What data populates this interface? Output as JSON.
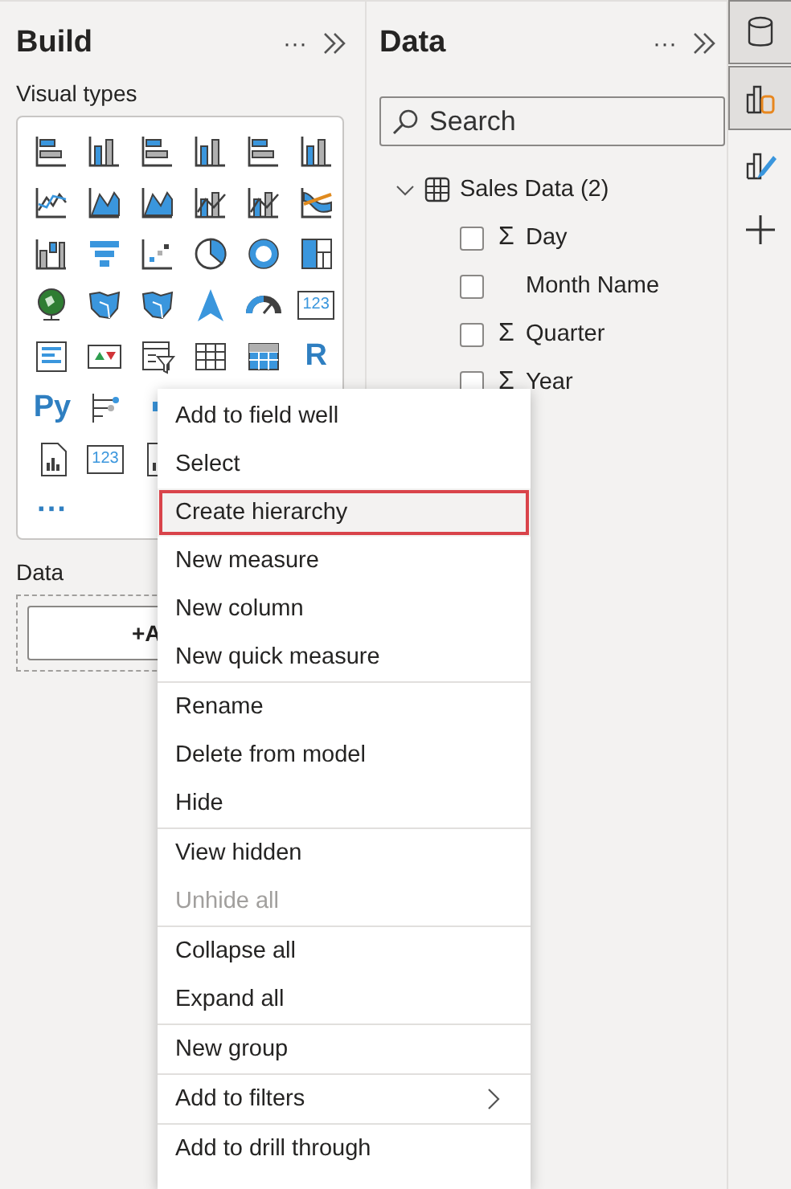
{
  "build_pane": {
    "title": "Build",
    "more": "···",
    "section_label": "Visual types",
    "visual_rows": [
      [
        {
          "kind": "hbar"
        },
        {
          "kind": "vbar"
        },
        {
          "kind": "hbar"
        },
        {
          "kind": "vbar"
        },
        {
          "kind": "hbar"
        },
        {
          "kind": "vbar"
        }
      ],
      [
        {
          "kind": "line"
        },
        {
          "kind": "area"
        },
        {
          "kind": "area"
        },
        {
          "kind": "combo"
        },
        {
          "kind": "combo"
        },
        {
          "kind": "ribbon"
        }
      ],
      [
        {
          "kind": "waterfall"
        },
        {
          "kind": "funnel"
        },
        {
          "kind": "scatter"
        },
        {
          "kind": "pie"
        },
        {
          "kind": "donut"
        },
        {
          "kind": "treemap"
        }
      ],
      [
        {
          "kind": "globe"
        },
        {
          "kind": "map"
        },
        {
          "kind": "map"
        },
        {
          "kind": "arrow"
        },
        {
          "kind": "gauge"
        },
        {
          "kind": "card",
          "text": "123"
        }
      ],
      [
        {
          "kind": "list"
        },
        {
          "kind": "kpi"
        },
        {
          "kind": "slicer"
        },
        {
          "kind": "table"
        },
        {
          "kind": "matrix"
        },
        {
          "kind": "letters",
          "text": "R"
        }
      ],
      [
        {
          "kind": "letters",
          "text": "Py"
        },
        {
          "kind": "tree"
        },
        {
          "kind": "key"
        }
      ],
      [
        {
          "kind": "report"
        },
        {
          "kind": "card",
          "text": "123"
        },
        {
          "kind": "report"
        }
      ],
      [
        {
          "kind": "letters",
          "text": "···"
        }
      ]
    ],
    "data_label": "Data",
    "add_button": "+A"
  },
  "data_pane": {
    "title": "Data",
    "more": "···",
    "search": {
      "placeholder": "Search"
    },
    "tables": [
      {
        "name": "Sales Data (2)",
        "expanded": true,
        "children": [
          {
            "name": "Day",
            "prefix": "Σ",
            "checked": false
          },
          {
            "name": "Month Name",
            "checked": false
          },
          {
            "name": "Quarter",
            "prefix": "Σ",
            "checked": false
          },
          {
            "name": "Year",
            "prefix": "Σ",
            "checked": false
          }
        ]
      }
    ]
  },
  "rail": [
    {
      "kind": "data",
      "selected": true
    },
    {
      "kind": "build",
      "selected": true
    },
    {
      "kind": "format",
      "selected": false
    },
    {
      "kind": "add",
      "selected": false
    }
  ],
  "context_menu": {
    "groups": [
      [
        {
          "label": "Add to field well",
          "selected": false,
          "disabled": false,
          "submenu": false
        },
        {
          "label": "Select",
          "selected": false,
          "disabled": false,
          "submenu": false
        },
        {
          "label": "Create hierarchy",
          "selected": true,
          "disabled": false,
          "submenu": false
        },
        {
          "label": "New measure",
          "selected": false,
          "disabled": false,
          "submenu": false
        },
        {
          "label": "New column",
          "selected": false,
          "disabled": false,
          "submenu": false
        },
        {
          "label": "New quick measure",
          "selected": false,
          "disabled": false,
          "submenu": false
        }
      ],
      [
        {
          "label": "Rename",
          "selected": false,
          "disabled": false,
          "submenu": false
        },
        {
          "label": "Delete from model",
          "selected": false,
          "disabled": false,
          "submenu": false
        },
        {
          "label": "Hide",
          "selected": false,
          "disabled": false,
          "submenu": false
        }
      ],
      [
        {
          "label": "View hidden",
          "selected": false,
          "disabled": false,
          "submenu": false
        },
        {
          "label": "Unhide all",
          "selected": false,
          "disabled": true,
          "submenu": false
        }
      ],
      [
        {
          "label": "Collapse all",
          "selected": false,
          "disabled": false,
          "submenu": false
        },
        {
          "label": "Expand all",
          "selected": false,
          "disabled": false,
          "submenu": false
        }
      ],
      [
        {
          "label": "New group",
          "selected": false,
          "disabled": false,
          "submenu": false
        }
      ],
      [
        {
          "label": "Add to filters",
          "selected": false,
          "disabled": false,
          "submenu": true
        }
      ],
      [
        {
          "label": "Add to drill through",
          "selected": false,
          "disabled": false,
          "submenu": false
        }
      ]
    ]
  }
}
